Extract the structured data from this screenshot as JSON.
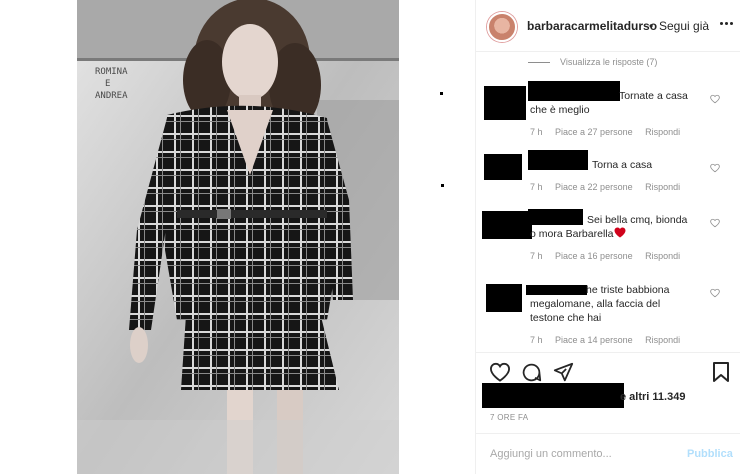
{
  "post": {
    "username": "barbaracarmelitadurso",
    "separator": "•",
    "follow_label": "Segui già"
  },
  "comments": {
    "view_replies": "Visualizza le risposte (7)",
    "items": [
      {
        "text_line1": "Tornate a casa",
        "text_line2": "che è meglio",
        "time": "7 h",
        "likes": "Piace a 27 persone",
        "reply": "Rispondi"
      },
      {
        "text_line1": "Torna a casa",
        "text_line2": "",
        "time": "7 h",
        "likes": "Piace a 22 persone",
        "reply": "Rispondi"
      },
      {
        "text_line1": "Sei bella cmq, bionda",
        "text_line2": "o mora Barbarella",
        "time": "7 h",
        "likes": "Piace a 16 persone",
        "reply": "Rispondi"
      },
      {
        "text_line1": "he triste babbiona",
        "text_line2": "megalomane, alla faccia del",
        "text_line3": "testone che hai",
        "time": "7 h",
        "likes": "Piace a 14 persone",
        "reply": "Rispondi"
      }
    ]
  },
  "actions": {
    "likes_suffix": "e altri 11.349",
    "date": "7 ORE FA"
  },
  "add_comment": {
    "placeholder": "Aggiungi un commento...",
    "publish_label": "Pubblica"
  },
  "colors": {
    "accent_disabled": "#b2dffc",
    "muted": "#8e8e8e",
    "heart_red": "#d0021b"
  }
}
